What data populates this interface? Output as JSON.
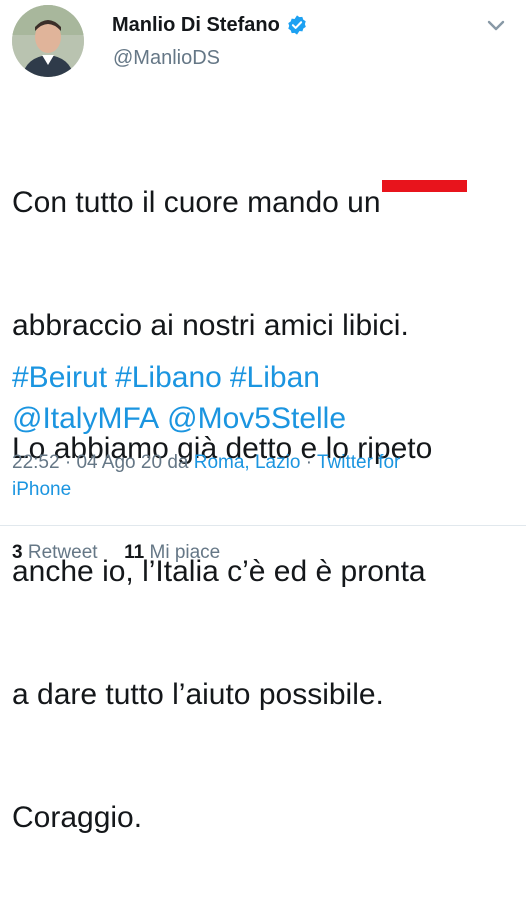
{
  "author": {
    "name": "Manlio Di Stefano",
    "handle": "@ManlioDS",
    "verified": true
  },
  "tweet": {
    "text_line1": "Con tutto il cuore mando un",
    "text_line2": "abbraccio ai nostri amici libici.",
    "text_line3": "Lo abbiamo già detto e lo ripeto",
    "text_line4": "anche io, l’Italia c’è ed è pronta",
    "text_line5": "a dare tutto l’aiuto possibile.",
    "text_line6": "Coraggio.",
    "hashtags": [
      "#Beirut",
      "#Libano",
      "#Liban"
    ],
    "mentions": [
      "@ItalyMFA",
      "@Mov5Stelle"
    ]
  },
  "meta": {
    "time": "22:52",
    "date": "04 Ago 20",
    "da": "da",
    "location": "Roma, Lazio",
    "source_line1": "Twitter for",
    "source_line2": "iPhone"
  },
  "stats": {
    "retweets_count": "3",
    "retweets_label": "Retweet",
    "likes_count": "11",
    "likes_label": "Mi piace"
  },
  "colors": {
    "link": "#1b95e0",
    "secondary": "#657786",
    "highlight": "#e8141c",
    "verified": "#1da1f2"
  },
  "icons": {
    "verified": "verified-badge-icon",
    "menu": "chevron-down-icon"
  }
}
